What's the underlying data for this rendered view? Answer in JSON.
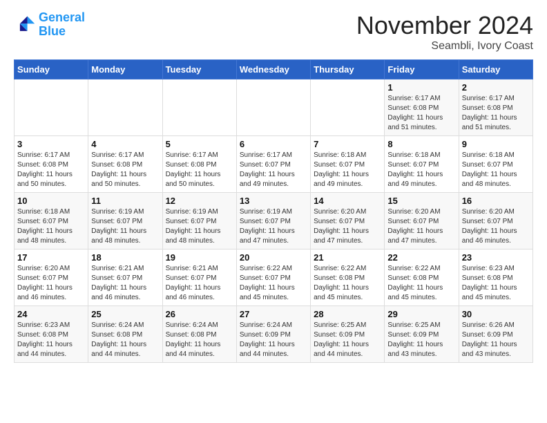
{
  "header": {
    "logo_line1": "General",
    "logo_line2": "Blue",
    "month": "November 2024",
    "location": "Seambli, Ivory Coast"
  },
  "weekdays": [
    "Sunday",
    "Monday",
    "Tuesday",
    "Wednesday",
    "Thursday",
    "Friday",
    "Saturday"
  ],
  "weeks": [
    {
      "days": [
        {
          "num": "",
          "info": ""
        },
        {
          "num": "",
          "info": ""
        },
        {
          "num": "",
          "info": ""
        },
        {
          "num": "",
          "info": ""
        },
        {
          "num": "",
          "info": ""
        },
        {
          "num": "1",
          "info": "Sunrise: 6:17 AM\nSunset: 6:08 PM\nDaylight: 11 hours\nand 51 minutes."
        },
        {
          "num": "2",
          "info": "Sunrise: 6:17 AM\nSunset: 6:08 PM\nDaylight: 11 hours\nand 51 minutes."
        }
      ]
    },
    {
      "days": [
        {
          "num": "3",
          "info": "Sunrise: 6:17 AM\nSunset: 6:08 PM\nDaylight: 11 hours\nand 50 minutes."
        },
        {
          "num": "4",
          "info": "Sunrise: 6:17 AM\nSunset: 6:08 PM\nDaylight: 11 hours\nand 50 minutes."
        },
        {
          "num": "5",
          "info": "Sunrise: 6:17 AM\nSunset: 6:08 PM\nDaylight: 11 hours\nand 50 minutes."
        },
        {
          "num": "6",
          "info": "Sunrise: 6:17 AM\nSunset: 6:07 PM\nDaylight: 11 hours\nand 49 minutes."
        },
        {
          "num": "7",
          "info": "Sunrise: 6:18 AM\nSunset: 6:07 PM\nDaylight: 11 hours\nand 49 minutes."
        },
        {
          "num": "8",
          "info": "Sunrise: 6:18 AM\nSunset: 6:07 PM\nDaylight: 11 hours\nand 49 minutes."
        },
        {
          "num": "9",
          "info": "Sunrise: 6:18 AM\nSunset: 6:07 PM\nDaylight: 11 hours\nand 48 minutes."
        }
      ]
    },
    {
      "days": [
        {
          "num": "10",
          "info": "Sunrise: 6:18 AM\nSunset: 6:07 PM\nDaylight: 11 hours\nand 48 minutes."
        },
        {
          "num": "11",
          "info": "Sunrise: 6:19 AM\nSunset: 6:07 PM\nDaylight: 11 hours\nand 48 minutes."
        },
        {
          "num": "12",
          "info": "Sunrise: 6:19 AM\nSunset: 6:07 PM\nDaylight: 11 hours\nand 48 minutes."
        },
        {
          "num": "13",
          "info": "Sunrise: 6:19 AM\nSunset: 6:07 PM\nDaylight: 11 hours\nand 47 minutes."
        },
        {
          "num": "14",
          "info": "Sunrise: 6:20 AM\nSunset: 6:07 PM\nDaylight: 11 hours\nand 47 minutes."
        },
        {
          "num": "15",
          "info": "Sunrise: 6:20 AM\nSunset: 6:07 PM\nDaylight: 11 hours\nand 47 minutes."
        },
        {
          "num": "16",
          "info": "Sunrise: 6:20 AM\nSunset: 6:07 PM\nDaylight: 11 hours\nand 46 minutes."
        }
      ]
    },
    {
      "days": [
        {
          "num": "17",
          "info": "Sunrise: 6:20 AM\nSunset: 6:07 PM\nDaylight: 11 hours\nand 46 minutes."
        },
        {
          "num": "18",
          "info": "Sunrise: 6:21 AM\nSunset: 6:07 PM\nDaylight: 11 hours\nand 46 minutes."
        },
        {
          "num": "19",
          "info": "Sunrise: 6:21 AM\nSunset: 6:07 PM\nDaylight: 11 hours\nand 46 minutes."
        },
        {
          "num": "20",
          "info": "Sunrise: 6:22 AM\nSunset: 6:07 PM\nDaylight: 11 hours\nand 45 minutes."
        },
        {
          "num": "21",
          "info": "Sunrise: 6:22 AM\nSunset: 6:08 PM\nDaylight: 11 hours\nand 45 minutes."
        },
        {
          "num": "22",
          "info": "Sunrise: 6:22 AM\nSunset: 6:08 PM\nDaylight: 11 hours\nand 45 minutes."
        },
        {
          "num": "23",
          "info": "Sunrise: 6:23 AM\nSunset: 6:08 PM\nDaylight: 11 hours\nand 45 minutes."
        }
      ]
    },
    {
      "days": [
        {
          "num": "24",
          "info": "Sunrise: 6:23 AM\nSunset: 6:08 PM\nDaylight: 11 hours\nand 44 minutes."
        },
        {
          "num": "25",
          "info": "Sunrise: 6:24 AM\nSunset: 6:08 PM\nDaylight: 11 hours\nand 44 minutes."
        },
        {
          "num": "26",
          "info": "Sunrise: 6:24 AM\nSunset: 6:08 PM\nDaylight: 11 hours\nand 44 minutes."
        },
        {
          "num": "27",
          "info": "Sunrise: 6:24 AM\nSunset: 6:09 PM\nDaylight: 11 hours\nand 44 minutes."
        },
        {
          "num": "28",
          "info": "Sunrise: 6:25 AM\nSunset: 6:09 PM\nDaylight: 11 hours\nand 44 minutes."
        },
        {
          "num": "29",
          "info": "Sunrise: 6:25 AM\nSunset: 6:09 PM\nDaylight: 11 hours\nand 43 minutes."
        },
        {
          "num": "30",
          "info": "Sunrise: 6:26 AM\nSunset: 6:09 PM\nDaylight: 11 hours\nand 43 minutes."
        }
      ]
    }
  ]
}
